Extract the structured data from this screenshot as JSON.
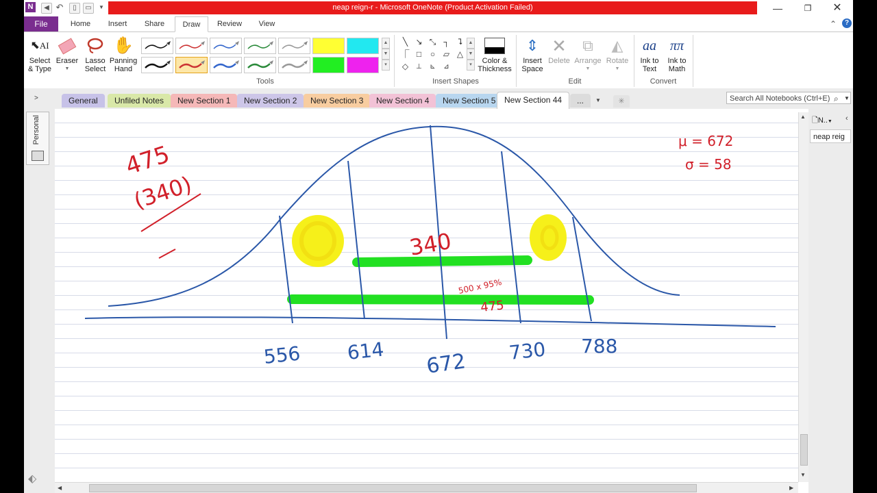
{
  "window": {
    "title": "neap reign-r - Microsoft OneNote (Product Activation Failed)",
    "colors": {
      "accent": "#7a2d8f",
      "banner": "#e81b1b"
    }
  },
  "ribbon_tabs": [
    "File",
    "Home",
    "Insert",
    "Share",
    "Draw",
    "Review",
    "View"
  ],
  "ribbon": {
    "tools": {
      "select_type": "Select\n& Type",
      "eraser": "Eraser",
      "lasso_select": "Lasso\nSelect",
      "panning_hand": "Panning\nHand",
      "group_label": "Tools"
    },
    "shapes": {
      "color_thickness": "Color &\nThickness",
      "group_label": "Insert Shapes"
    },
    "edit": {
      "insert_space": "Insert\nSpace",
      "delete": "Delete",
      "arrange": "Arrange",
      "rotate": "Rotate",
      "group_label": "Edit"
    },
    "convert": {
      "ink_to_text": "Ink to\nText",
      "ink_to_math": "Ink to\nMath",
      "group_label": "Convert"
    }
  },
  "sections": [
    {
      "label": "General",
      "color": "#c7c2e8"
    },
    {
      "label": "Unfiled Notes",
      "color": "#d9e8a8"
    },
    {
      "label": "New Section 1",
      "color": "#f5b8b8"
    },
    {
      "label": "New Section 2",
      "color": "#cdc6e8"
    },
    {
      "label": "New Section 3",
      "color": "#f8cda0"
    },
    {
      "label": "New Section 4",
      "color": "#f2c2d6"
    },
    {
      "label": "New Section 5",
      "color": "#b8d6ef"
    },
    {
      "label": "New Section 44",
      "color": "#ffffff"
    },
    {
      "label": "...",
      "color": "#dcdcdc"
    }
  ],
  "search": {
    "placeholder": "Search All Notebooks (Ctrl+E)"
  },
  "notebook": {
    "name": "Personal"
  },
  "page_pane": {
    "header": "N..",
    "page_title": "neap reig"
  },
  "ink": {
    "mu": "μ = 672",
    "sigma": "σ = 58",
    "top_left_a": "475",
    "top_left_b": "(340)",
    "middle_label": "340",
    "small_note": "500 x 95%",
    "lower_label": "475",
    "axis_values": [
      "556",
      "614",
      "672",
      "730",
      "788"
    ],
    "ink_colors": {
      "blue": "#2a57a8",
      "red": "#d1202a",
      "green": "#22e022",
      "yellow": "#f6f01a"
    }
  }
}
